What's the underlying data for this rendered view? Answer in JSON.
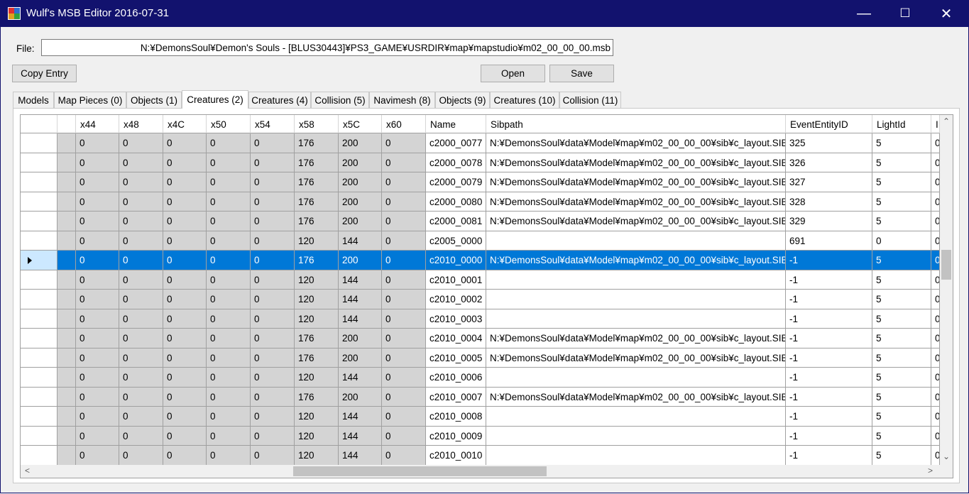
{
  "window": {
    "title": "Wulf's MSB Editor 2016-07-31",
    "minimize_glyph": "—",
    "maximize_glyph": "☐",
    "close_glyph": "✕"
  },
  "file": {
    "label": "File:",
    "path": "N:¥DemonsSoul¥Demon's Souls - [BLUS30443]¥PS3_GAME¥USRDIR¥map¥mapstudio¥m02_00_00_00.msb"
  },
  "buttons": {
    "copy_entry": "Copy Entry",
    "open": "Open",
    "save": "Save"
  },
  "tabs": [
    {
      "label": "Models"
    },
    {
      "label": "Map Pieces (0)"
    },
    {
      "label": "Objects (1)"
    },
    {
      "label": "Creatures (2)"
    },
    {
      "label": "Creatures (4)"
    },
    {
      "label": "Collision (5)"
    },
    {
      "label": "Navimesh (8)"
    },
    {
      "label": "Objects (9)"
    },
    {
      "label": "Creatures (10)"
    },
    {
      "label": "Collision (11)"
    }
  ],
  "active_tab": "Creatures (2)",
  "grid": {
    "columns": [
      "x44",
      "x48",
      "x4C",
      "x50",
      "x54",
      "x58",
      "x5C",
      "x60",
      "Name",
      "Sibpath",
      "EventEntityID",
      "LightId",
      "I"
    ],
    "selected_row": 6,
    "rows": [
      [
        "0",
        "0",
        "0",
        "0",
        "0",
        "176",
        "200",
        "0",
        "c2000_0077",
        "N:¥DemonsSoul¥data¥Model¥map¥m02_00_00_00¥sib¥c_layout.SIB",
        "325",
        "5",
        "0"
      ],
      [
        "0",
        "0",
        "0",
        "0",
        "0",
        "176",
        "200",
        "0",
        "c2000_0078",
        "N:¥DemonsSoul¥data¥Model¥map¥m02_00_00_00¥sib¥c_layout.SIB",
        "326",
        "5",
        "0"
      ],
      [
        "0",
        "0",
        "0",
        "0",
        "0",
        "176",
        "200",
        "0",
        "c2000_0079",
        "N:¥DemonsSoul¥data¥Model¥map¥m02_00_00_00¥sib¥c_layout.SIB",
        "327",
        "5",
        "0"
      ],
      [
        "0",
        "0",
        "0",
        "0",
        "0",
        "176",
        "200",
        "0",
        "c2000_0080",
        "N:¥DemonsSoul¥data¥Model¥map¥m02_00_00_00¥sib¥c_layout.SIB",
        "328",
        "5",
        "0"
      ],
      [
        "0",
        "0",
        "0",
        "0",
        "0",
        "176",
        "200",
        "0",
        "c2000_0081",
        "N:¥DemonsSoul¥data¥Model¥map¥m02_00_00_00¥sib¥c_layout.SIB",
        "329",
        "5",
        "0"
      ],
      [
        "0",
        "0",
        "0",
        "0",
        "0",
        "120",
        "144",
        "0",
        "c2005_0000",
        "",
        "691",
        "0",
        "0"
      ],
      [
        "0",
        "0",
        "0",
        "0",
        "0",
        "176",
        "200",
        "0",
        "c2010_0000",
        "N:¥DemonsSoul¥data¥Model¥map¥m02_00_00_00¥sib¥c_layout.SIB",
        "-1",
        "5",
        "0"
      ],
      [
        "0",
        "0",
        "0",
        "0",
        "0",
        "120",
        "144",
        "0",
        "c2010_0001",
        "",
        "-1",
        "5",
        "0"
      ],
      [
        "0",
        "0",
        "0",
        "0",
        "0",
        "120",
        "144",
        "0",
        "c2010_0002",
        "",
        "-1",
        "5",
        "0"
      ],
      [
        "0",
        "0",
        "0",
        "0",
        "0",
        "120",
        "144",
        "0",
        "c2010_0003",
        "",
        "-1",
        "5",
        "0"
      ],
      [
        "0",
        "0",
        "0",
        "0",
        "0",
        "176",
        "200",
        "0",
        "c2010_0004",
        "N:¥DemonsSoul¥data¥Model¥map¥m02_00_00_00¥sib¥c_layout.SIB",
        "-1",
        "5",
        "0"
      ],
      [
        "0",
        "0",
        "0",
        "0",
        "0",
        "176",
        "200",
        "0",
        "c2010_0005",
        "N:¥DemonsSoul¥data¥Model¥map¥m02_00_00_00¥sib¥c_layout.SIB",
        "-1",
        "5",
        "0"
      ],
      [
        "0",
        "0",
        "0",
        "0",
        "0",
        "120",
        "144",
        "0",
        "c2010_0006",
        "",
        "-1",
        "5",
        "0"
      ],
      [
        "0",
        "0",
        "0",
        "0",
        "0",
        "176",
        "200",
        "0",
        "c2010_0007",
        "N:¥DemonsSoul¥data¥Model¥map¥m02_00_00_00¥sib¥c_layout.SIB",
        "-1",
        "5",
        "0"
      ],
      [
        "0",
        "0",
        "0",
        "0",
        "0",
        "120",
        "144",
        "0",
        "c2010_0008",
        "",
        "-1",
        "5",
        "0"
      ],
      [
        "0",
        "0",
        "0",
        "0",
        "0",
        "120",
        "144",
        "0",
        "c2010_0009",
        "",
        "-1",
        "5",
        "0"
      ],
      [
        "0",
        "0",
        "0",
        "0",
        "0",
        "120",
        "144",
        "0",
        "c2010_0010",
        "",
        "-1",
        "5",
        "0"
      ]
    ]
  },
  "colors": {
    "titlebar": "#12126e",
    "selection": "#0078d7",
    "readonly_cell": "#d4d4d4"
  }
}
